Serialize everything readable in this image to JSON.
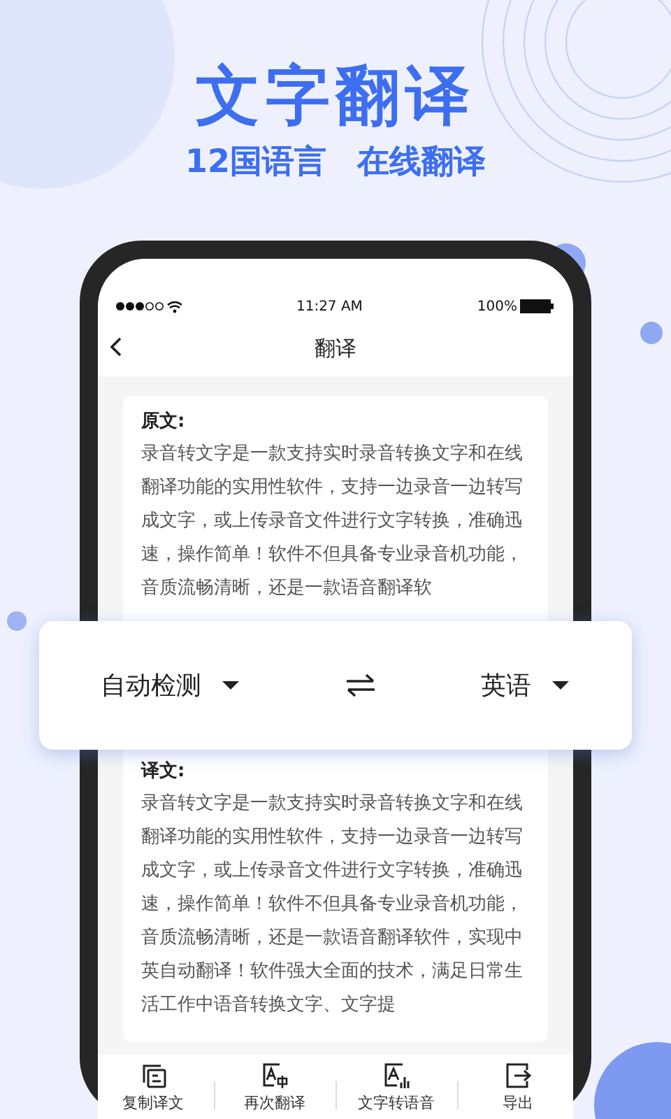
{
  "promo": {
    "title": "文字翻译",
    "subtitle": [
      "12国语言",
      "在线翻译"
    ]
  },
  "status_bar": {
    "time": "11:27 AM",
    "battery": "100%"
  },
  "nav": {
    "title": "翻译"
  },
  "source": {
    "label": "原文:",
    "text": "录音转文字是一款支持实时录音转换文字和在线翻译功能的实用性软件，支持一边录音一边转写成文字，或上传录音文件进行文字转换，准确迅速，操作简单！软件不但具备专业录音机功能，音质流畅清晰，还是一款语音翻译软"
  },
  "language_bar": {
    "from": "自动检测",
    "to": "英语"
  },
  "translation": {
    "label": "译文:",
    "text": "录音转文字是一款支持实时录音转换文字和在线翻译功能的实用性软件，支持一边录音一边转写成文字，或上传录音文件进行文字转换，准确迅速，操作简单！软件不但具备专业录音机功能，音质流畅清晰，还是一款语音翻译软件，实现中英自动翻译！软件强大全面的技术，满足日常生活工作中语音转换文字、文字提"
  },
  "toolbar": [
    {
      "kind": "copy",
      "label": "复制译文"
    },
    {
      "kind": "translate",
      "label": "再次翻译"
    },
    {
      "kind": "speech",
      "label": "文字转语音"
    },
    {
      "kind": "export",
      "label": "导出"
    }
  ]
}
